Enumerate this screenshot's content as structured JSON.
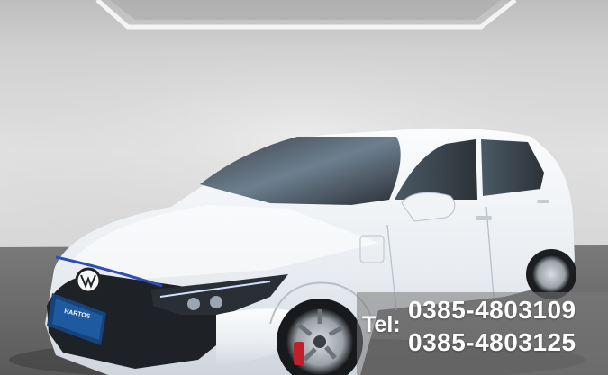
{
  "image": {
    "subject": "white-hatchback-car",
    "colors": {
      "car_body": "#eef1f4",
      "wall": "#dcdcdc",
      "floor": "#6e6e6e",
      "accent_trim": "#2d4fb5",
      "caliper": "#c0202a"
    }
  },
  "plate": {
    "dealer_text": "HARTOS"
  },
  "contact": {
    "tel_label": "Tel:",
    "phone_1": "0385-4803109",
    "phone_2": "0385-4803125"
  }
}
